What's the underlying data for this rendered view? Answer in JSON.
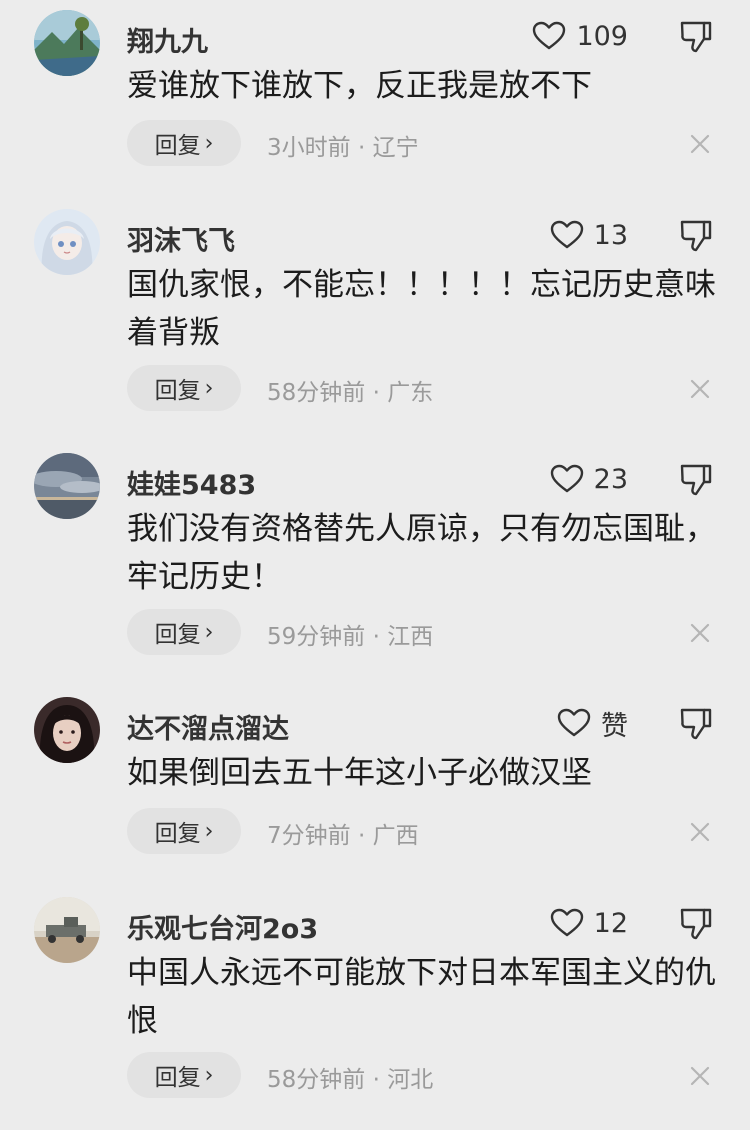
{
  "comments": [
    {
      "username": "翔九九",
      "likes": "109",
      "text": "爱谁放下谁放下，反正我是放不下",
      "reply_label": "回复",
      "time": "3小时前",
      "location": "辽宁",
      "avatar_icon": "landscape-avatar-icon"
    },
    {
      "username": "羽沫飞飞",
      "likes": "13",
      "text": "国仇家恨，不能忘！！！！！忘记历史意味着背叛",
      "reply_label": "回复",
      "time": "58分钟前",
      "location": "广东",
      "avatar_icon": "anime-girl-avatar-icon"
    },
    {
      "username": "娃娃5483",
      "likes": "23",
      "text": "我们没有资格替先人原谅，只有勿忘国耻，牢记历史！",
      "reply_label": "回复",
      "time": "59分钟前",
      "location": "江西",
      "avatar_icon": "sky-avatar-icon"
    },
    {
      "username": "达不溜点溜达",
      "likes": "赞",
      "text": "如果倒回去五十年这小子必做汉坚",
      "reply_label": "回复",
      "time": "7分钟前",
      "location": "广西",
      "avatar_icon": "woman-avatar-icon"
    },
    {
      "username": "乐观七台河2o3",
      "likes": "12",
      "text": "中国人永远不可能放下对日本军国主义的仇恨",
      "reply_label": "回复",
      "time": "58分钟前",
      "location": "河北",
      "avatar_icon": "vehicle-avatar-icon"
    }
  ],
  "separator": " · ",
  "icons": {
    "like": "heart-icon",
    "dislike": "thumbs-down-icon",
    "close": "close-icon",
    "reply_chevron": "chevron-right-icon"
  },
  "colors": {
    "background": "#ececec",
    "reply_button": "#e2e2e2",
    "meta_text": "#9a9a9a"
  }
}
